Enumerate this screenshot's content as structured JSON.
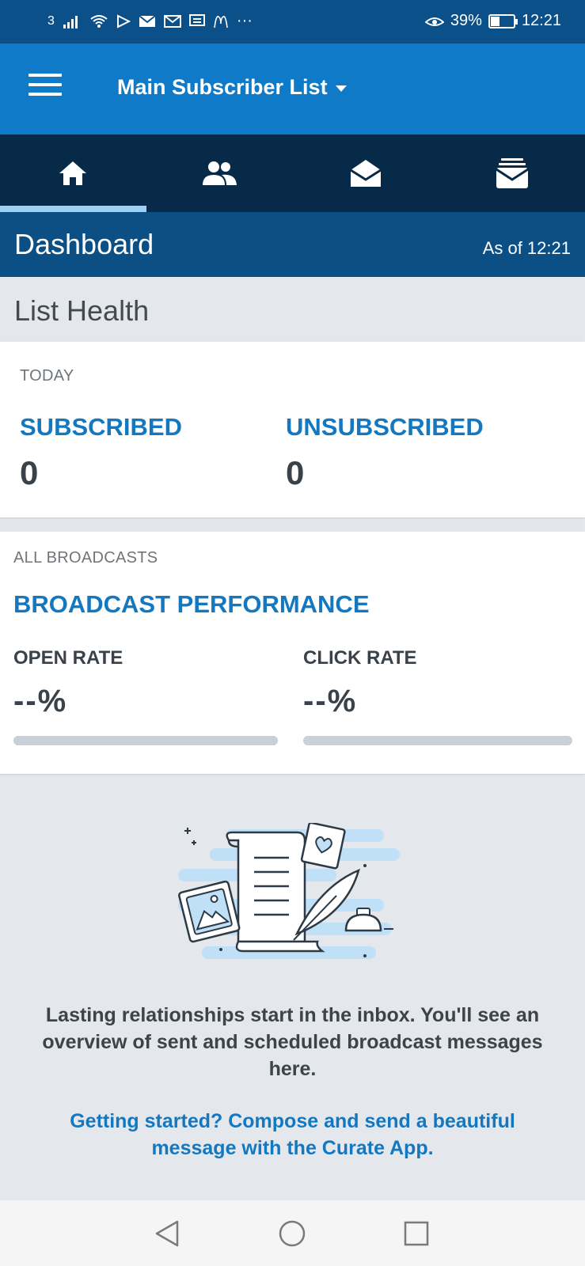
{
  "status_bar": {
    "carrier": "3",
    "battery": "39%",
    "battery_level": 0.39,
    "time": "12:21",
    "more": "···"
  },
  "app_bar": {
    "list_name": "Main Subscriber List"
  },
  "tabs": [
    {
      "icon": "home-icon",
      "active": true
    },
    {
      "icon": "subscribers-icon",
      "active": false
    },
    {
      "icon": "broadcast-open-envelope-icon",
      "active": false
    },
    {
      "icon": "sent-messages-icon",
      "active": false
    }
  ],
  "dashboard": {
    "title": "Dashboard",
    "as_of": "As of 12:21"
  },
  "list_health": {
    "title": "List Health",
    "period": "TODAY",
    "subscribed_label": "SUBSCRIBED",
    "subscribed_value": "0",
    "unsubscribed_label": "UNSUBSCRIBED",
    "unsubscribed_value": "0"
  },
  "broadcasts": {
    "scope": "ALL BROADCASTS",
    "title": "BROADCAST PERFORMANCE",
    "open_rate_label": "OPEN RATE",
    "open_rate_value": "--%",
    "open_rate_level": 0,
    "click_rate_label": "CLICK RATE",
    "click_rate_value": "--%",
    "click_rate_level": 0
  },
  "empty_state": {
    "message": "Lasting relationships start in the inbox. You'll see an overview of sent and scheduled broadcast messages here.",
    "cta": "Getting started? Compose and send a beautiful message with the Curate App."
  },
  "colors": {
    "brand_blue": "#0f7ac8",
    "accent_blue": "#1478c0",
    "dark_navy": "#062a47",
    "header_blue": "#0c4f85"
  }
}
